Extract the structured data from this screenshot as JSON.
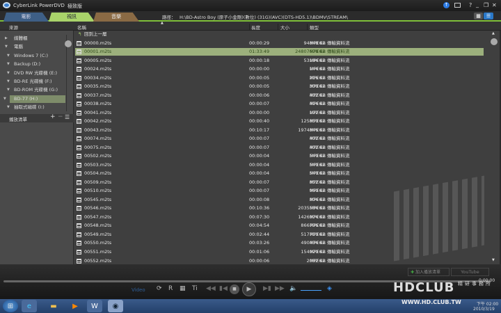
{
  "app": {
    "title": "CyberLink PowerDVD",
    "edition": "極致版"
  },
  "tabs": [
    {
      "label": "電影",
      "color": "#3e5f86"
    },
    {
      "label": "視訊",
      "color": "#a9d36a"
    },
    {
      "label": "音樂",
      "color": "#8a6a44"
    }
  ],
  "path": {
    "label": "路徑：",
    "value": "H:\\BD-Astro Boy (原子小金剛)(數位) (31G)(AVC)(DTS-HD5.1)\\BDMV\\STREAM\\"
  },
  "sidebar": {
    "header": "來源",
    "items": [
      {
        "label": "媒體櫃",
        "arrow": "▶"
      },
      {
        "label": "電腦",
        "arrow": "▼"
      },
      {
        "label": "Windows 7 (C:)",
        "arrow": "▼"
      },
      {
        "label": "Backup (D:)",
        "arrow": "▼"
      },
      {
        "label": "DVD RW 光碟機 (E:)",
        "arrow": "▼"
      },
      {
        "label": "BD-RE 光碟機 (F:)",
        "arrow": "▼"
      },
      {
        "label": "BD-ROM 光碟機 (G:)",
        "arrow": "▼"
      },
      {
        "label": "BD-77 (H:)",
        "arrow": "▼",
        "selected": true
      },
      {
        "label": "抽取式磁碟 (I:)",
        "arrow": "▼"
      }
    ],
    "playlist": "播放清單"
  },
  "columns": {
    "name": "名稱",
    "length": "長度",
    "size": "大小",
    "type": "類型"
  },
  "up_item": "回到上一層",
  "files": [
    [
      "00000.m2ts",
      "00:00:29",
      "94848 KB"
    ],
    [
      "00001.m2ts",
      "01:33:49",
      "24807678 KB"
    ],
    [
      "00005.m2ts",
      "00:00:18",
      "53184 KB"
    ],
    [
      "00024.m2ts",
      "00:00:00",
      "144 KB"
    ],
    [
      "00034.m2ts",
      "00:00:05",
      "216 KB"
    ],
    [
      "00035.m2ts",
      "00:00:05",
      "300 KB"
    ],
    [
      "00037.m2ts",
      "00:00:06",
      "432 KB"
    ],
    [
      "00038.m2ts",
      "00:00:07",
      "414 KB"
    ],
    [
      "00041.m2ts",
      "00:00:00",
      "192 KB"
    ],
    [
      "00042.m2ts",
      "00:00:40",
      "125850 KB"
    ],
    [
      "00043.m2ts",
      "00:10:17",
      "1974846 KB"
    ],
    [
      "00074.m2ts",
      "00:00:07",
      "402 KB"
    ],
    [
      "00075.m2ts",
      "00:00:07",
      "402 KB"
    ],
    [
      "00502.m2ts",
      "00:00:04",
      "540 KB"
    ],
    [
      "00503.m2ts",
      "00:00:04",
      "540 KB"
    ],
    [
      "00504.m2ts",
      "00:00:04",
      "540 KB"
    ],
    [
      "00509.m2ts",
      "00:00:07",
      "852 KB"
    ],
    [
      "00510.m2ts",
      "00:00:07",
      "960 KB"
    ],
    [
      "00545.m2ts",
      "00:00:08",
      "804 KB"
    ],
    [
      "00546.m2ts",
      "00:10:36",
      "2035584 KB"
    ],
    [
      "00547.m2ts",
      "00:07:30",
      "1426974 KB"
    ],
    [
      "00548.m2ts",
      "00:04:54",
      "866796 KB"
    ],
    [
      "00549.m2ts",
      "00:02:44",
      "517710 KB"
    ],
    [
      "00550.m2ts",
      "00:03:26",
      "490434 KB"
    ],
    [
      "00551.m2ts",
      "00:01:06",
      "154920 KB"
    ],
    [
      "00552.m2ts",
      "00:00:06",
      "2082 KB"
    ]
  ],
  "file_type": "MPEG2 傳輸資料流",
  "selected_file": 1,
  "buttons": {
    "add_playlist": "加入播放清單",
    "youtube": "YouTube"
  },
  "player": {
    "mode": "Video",
    "time": "0:00:00"
  },
  "watermark": {
    "logo": "HDCLUB",
    "sub": "精研事務所",
    "url": "WWW.HD.CLUB.TW"
  },
  "clock": {
    "time": "下午 02:00",
    "date": "2010/3/19"
  }
}
